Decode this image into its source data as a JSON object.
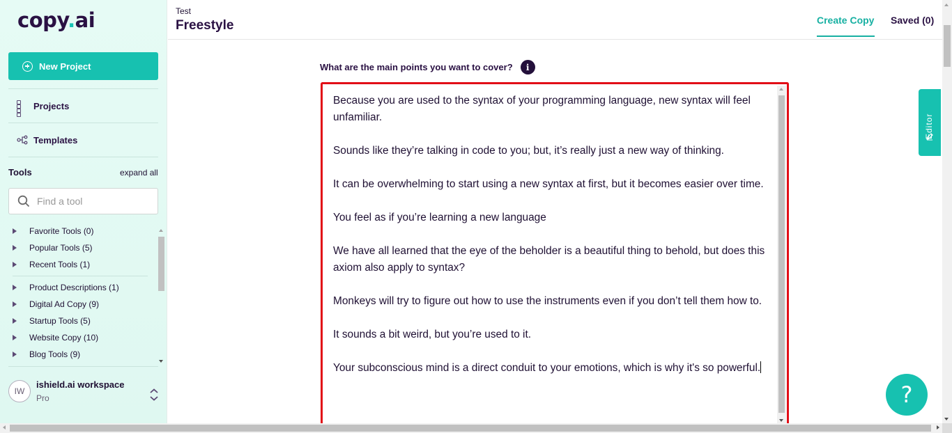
{
  "brand": {
    "logo_main": "copy",
    "logo_dot": ".",
    "logo_tail": "ai",
    "accent": "#17c1b0"
  },
  "sidebar": {
    "new_project_label": "New Project",
    "nav": [
      {
        "label": "Projects",
        "icon": "grid-icon"
      },
      {
        "label": "Templates",
        "icon": "templates-icon"
      }
    ],
    "tools_title": "Tools",
    "expand_all": "expand all",
    "search_placeholder": "Find a tool",
    "tool_groups_top": [
      "Favorite Tools (0)",
      "Popular Tools (5)",
      "Recent Tools (1)"
    ],
    "tool_groups": [
      "Product Descriptions (1)",
      "Digital Ad Copy (9)",
      "Startup Tools (5)",
      "Website Copy (10)",
      "Blog Tools (9)"
    ],
    "workspace": {
      "initials": "IW",
      "name": "ishield.ai workspace",
      "plan": "Pro"
    }
  },
  "header": {
    "breadcrumb": "Test",
    "title": "Freestyle",
    "tabs": [
      {
        "label": "Create Copy",
        "active": true
      },
      {
        "label": "Saved (0)",
        "active": false
      }
    ]
  },
  "main": {
    "question": "What are the main points you want to cover?",
    "info_icon_text": "i",
    "paragraphs": [
      "Because you are used to the syntax of your programming language, new syntax will feel unfamiliar.",
      "Sounds like they’re talking in code to you; but, it’s really just a new way of thinking.",
      "It can be overwhelming to start using a new syntax at first, but it becomes easier over time.",
      "You feel as if you’re learning a new language",
      "We have all learned that the eye of the beholder is a beautiful thing to behold, but does this axiom also apply to syntax?",
      "Monkeys will try to figure out how to use the instruments even if you don’t tell them how to.",
      "It sounds a bit weird, but you’re used to it.",
      "Your subconscious mind is a direct conduit to your emotions, which is why it's so powerful."
    ]
  },
  "editor_tab_label": "Editor",
  "help_label": "?"
}
